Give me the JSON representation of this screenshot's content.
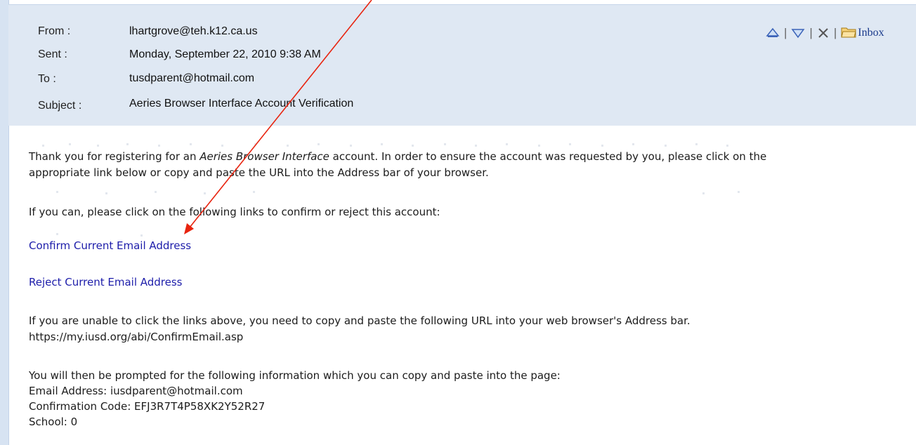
{
  "header": {
    "fields": [
      {
        "label": "From :",
        "value": "lhartgrove@teh.k12.ca.us"
      },
      {
        "label": "Sent :",
        "value": "Monday, September 22, 2010 9:38 AM"
      },
      {
        "label": "To :",
        "value": "tusdparent@hotmail.com"
      },
      {
        "label": "Subject :",
        "value": "Aeries Browser Interface Account Verification"
      }
    ],
    "toolbar": {
      "up_icon": "up-arrow-icon",
      "down_icon": "down-arrow-icon",
      "delete_icon": "close-icon",
      "folder_icon": "folder-icon",
      "inbox_label": "Inbox"
    }
  },
  "message": {
    "intro_1a": "Thank you for registering for an ",
    "intro_1_italic": "Aeries Browser Interface",
    "intro_1b": " account. In order to ensure the account was requested by you, please click on the",
    "intro_2": "appropriate link below or copy and paste the URL into the Address bar of your browser.",
    "prompt": "If you can, please click on the following links to confirm or reject this account:",
    "confirm_link": "Confirm Current Email Address",
    "reject_link": "Reject Current Email Address",
    "unable_1": "If you are unable to click the links above, you need to copy and paste the following URL into your web browser's Address bar.",
    "url": "https://my.iusd.org/abi/ConfirmEmail.asp",
    "prompted": "You will then be prompted for the following information which you can copy and paste into the page:",
    "email_line": "Email Address: iusdparent@hotmail.com",
    "code_line": "Confirmation Code: EFJ3R7T4P58XK2Y52R27",
    "school_line": "School: 0"
  },
  "colors": {
    "header_bg": "#dfe8f3",
    "link": "#1d1daa",
    "annotation_arrow": "#e8230e"
  }
}
